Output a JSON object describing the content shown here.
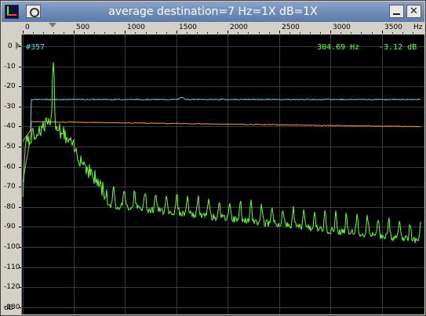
{
  "window": {
    "title": "average   destination=7 Hz=1X dB=1X"
  },
  "frequency_axis": {
    "unit": "Hz",
    "labels": [
      "0",
      "500",
      "1000",
      "1500",
      "2000",
      "2500",
      "3000",
      "3500"
    ],
    "values": [
      0,
      500,
      1000,
      1500,
      2000,
      2500,
      3000,
      3500
    ],
    "max": 3920
  },
  "db_axis": {
    "unit": "dB",
    "labels": [
      "0",
      "-10",
      "-20",
      "-30",
      "-40",
      "-50",
      "-60",
      "-70",
      "-80",
      "-90",
      "-100",
      "-110",
      "-120",
      "-130"
    ],
    "values": [
      0,
      -10,
      -20,
      -30,
      -40,
      -50,
      -60,
      -70,
      -80,
      -90,
      -100,
      -110,
      -120,
      -130
    ],
    "min": -135
  },
  "readout": {
    "frame": "#357",
    "frequency": "304.69 Hz",
    "level": "-3.12 dB"
  },
  "colors": {
    "background": "#000000",
    "grid": "#3a3a3a",
    "spectrum": "#66ff33",
    "average": "#5fd3e6",
    "peak_hold": "#e89a4a",
    "readout_frame": "#5fd3e6",
    "readout_value": "#66ff33"
  },
  "icons": {
    "app": "spectrum-analyzer-icon",
    "menu": "window-menu-icon",
    "minimize": "minimize-icon",
    "close": "close-icon"
  }
}
